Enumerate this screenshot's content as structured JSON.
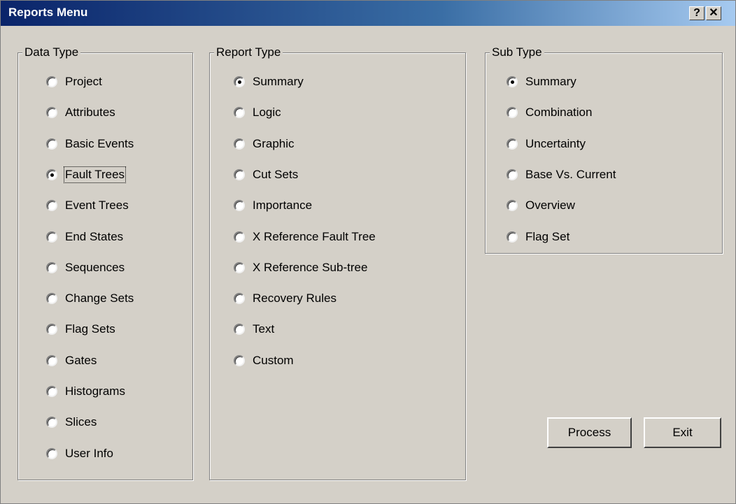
{
  "window": {
    "title": "Reports Menu",
    "help_label": "?",
    "close_label": "✕"
  },
  "data_type": {
    "label": "Data Type",
    "options": [
      {
        "label": "Project",
        "checked": false
      },
      {
        "label": "Attributes",
        "checked": false
      },
      {
        "label": "Basic Events",
        "checked": false
      },
      {
        "label": "Fault Trees",
        "checked": true
      },
      {
        "label": "Event Trees",
        "checked": false
      },
      {
        "label": "End States",
        "checked": false
      },
      {
        "label": "Sequences",
        "checked": false
      },
      {
        "label": "Change Sets",
        "checked": false
      },
      {
        "label": "Flag Sets",
        "checked": false
      },
      {
        "label": "Gates",
        "checked": false
      },
      {
        "label": "Histograms",
        "checked": false
      },
      {
        "label": "Slices",
        "checked": false
      },
      {
        "label": "User Info",
        "checked": false
      }
    ]
  },
  "report_type": {
    "label": "Report Type",
    "options": [
      {
        "label": "Summary",
        "checked": true
      },
      {
        "label": "Logic",
        "checked": false
      },
      {
        "label": "Graphic",
        "checked": false
      },
      {
        "label": "Cut Sets",
        "checked": false
      },
      {
        "label": "Importance",
        "checked": false
      },
      {
        "label": "X Reference Fault Tree",
        "checked": false
      },
      {
        "label": "X Reference Sub-tree",
        "checked": false
      },
      {
        "label": "Recovery Rules",
        "checked": false
      },
      {
        "label": "Text",
        "checked": false
      },
      {
        "label": "Custom",
        "checked": false
      }
    ]
  },
  "sub_type": {
    "label": "Sub Type",
    "options": [
      {
        "label": "Summary",
        "checked": true
      },
      {
        "label": "Combination",
        "checked": false
      },
      {
        "label": "Uncertainty",
        "checked": false
      },
      {
        "label": "Base Vs. Current",
        "checked": false
      },
      {
        "label": "Overview",
        "checked": false
      },
      {
        "label": "Flag Set",
        "checked": false
      }
    ]
  },
  "buttons": {
    "process_label": "Process",
    "exit_label": "Exit"
  },
  "colors": {
    "window_bg": "#d4d0c8",
    "title_bg_start": "#0a246a",
    "title_bg_end": "#a6caf0",
    "title_text": "#ffffff"
  }
}
